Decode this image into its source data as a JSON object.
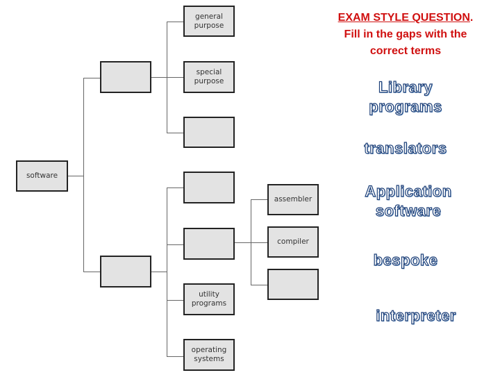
{
  "heading": {
    "title": "EXAM STYLE QUESTION",
    "title_suffix": ".",
    "line2": "Fill in the gaps with the",
    "line3": "correct terms",
    "color": "#d01010"
  },
  "diagram": {
    "root": "software",
    "branch_top": "",
    "branch_top_children": [
      "general\npurpose",
      "special\npurpose",
      ""
    ],
    "branch_bottom": "",
    "branch_bottom_children": [
      "",
      "",
      "utility\nprograms",
      "operating\nsystems"
    ],
    "translator_children": [
      "assembler",
      "compiler",
      ""
    ]
  },
  "terms": {
    "items": [
      "Library\nprograms",
      "translators",
      "Application\nsoftware",
      "bespoke",
      "interpreter"
    ],
    "outline_color": "#1c3f78"
  }
}
